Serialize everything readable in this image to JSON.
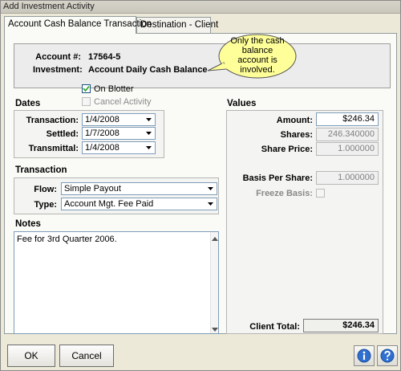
{
  "window": {
    "title": "Add Investment Activity"
  },
  "tabs": [
    {
      "label": "Account Cash Balance Transaction"
    },
    {
      "label": "Destination - Client"
    }
  ],
  "header": {
    "account_label": "Account #:",
    "account_value": "17564-5",
    "investment_label": "Investment:",
    "investment_value": "Account Daily Cash Balance"
  },
  "callout": {
    "lines": [
      "Only the cash",
      "balance",
      "account is",
      "involved."
    ]
  },
  "options": {
    "on_blotter_label": "On Blotter",
    "on_blotter_checked": true,
    "cancel_activity_label": "Cancel Activity",
    "cancel_activity_checked": false
  },
  "dates": {
    "title": "Dates",
    "transaction_label": "Transaction:",
    "transaction_value": "1/4/2008",
    "settled_label": "Settled:",
    "settled_value": "1/7/2008",
    "transmittal_label": "Transmittal:",
    "transmittal_value": "1/4/2008"
  },
  "transaction": {
    "title": "Transaction",
    "flow_label": "Flow:",
    "flow_value": "Simple Payout",
    "type_label": "Type:",
    "type_value": "Account Mgt. Fee Paid"
  },
  "notes": {
    "title": "Notes",
    "text": "Fee for 3rd Quarter 2006."
  },
  "values": {
    "title": "Values",
    "amount_label": "Amount:",
    "amount_value": "$246.34",
    "shares_label": "Shares:",
    "shares_value": "246.340000",
    "share_price_label": "Share Price:",
    "share_price_value": "1.000000",
    "basis_label": "Basis Per Share:",
    "basis_value": "1.000000",
    "freeze_label": "Freeze Basis:",
    "client_total_label": "Client Total:",
    "client_total_value": "$246.34"
  },
  "footer": {
    "ok_label": "OK",
    "cancel_label": "Cancel"
  }
}
